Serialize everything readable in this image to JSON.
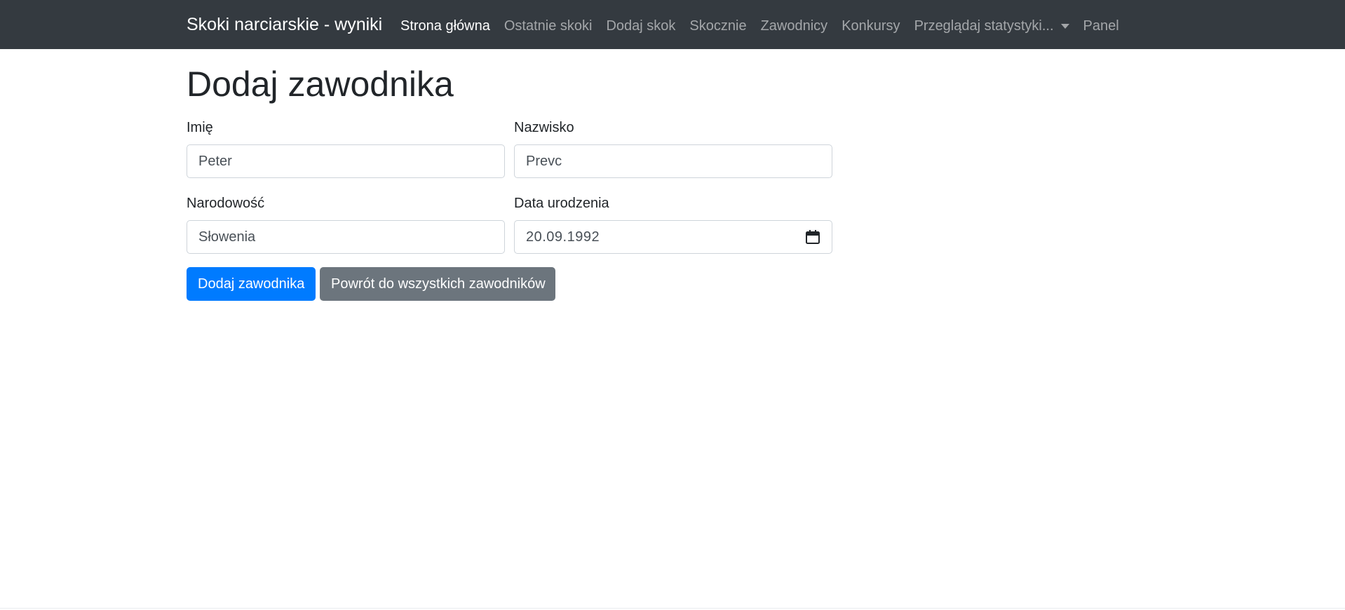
{
  "navbar": {
    "brand": "Skoki narciarskie - wyniki",
    "items": [
      {
        "label": "Strona główna",
        "active": true
      },
      {
        "label": "Ostatnie skoki",
        "active": false
      },
      {
        "label": "Dodaj skok",
        "active": false
      },
      {
        "label": "Skocznie",
        "active": false
      },
      {
        "label": "Zawodnicy",
        "active": false
      },
      {
        "label": "Konkursy",
        "active": false
      },
      {
        "label": "Przeglądaj statystyki...",
        "active": false,
        "dropdown": true
      },
      {
        "label": "Panel",
        "active": false
      }
    ]
  },
  "main": {
    "title": "Dodaj zawodnika",
    "form": {
      "first_name": {
        "label": "Imię",
        "value": "Peter"
      },
      "last_name": {
        "label": "Nazwisko",
        "value": "Prevc"
      },
      "nationality": {
        "label": "Narodowość",
        "value": "Słowenia"
      },
      "birth_date": {
        "label": "Data urodzenia",
        "value": "20.09.1992",
        "icon": "calendar-icon"
      }
    },
    "buttons": {
      "submit_label": "Dodaj zawodnika",
      "back_label": "Powrót do wszystkich zawodników"
    }
  },
  "colors": {
    "navbar_bg": "#343a40",
    "primary": "#007bff",
    "secondary": "#6c757d"
  }
}
